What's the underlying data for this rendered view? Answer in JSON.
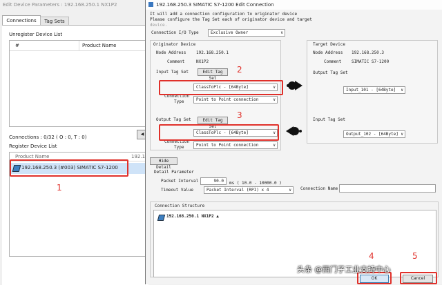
{
  "back_window": {
    "title": "Edit Device Parameters : 192.168.250.1 NX1P2",
    "tabs": [
      "Connections",
      "Tag Sets"
    ],
    "unregister_label": "Unregister Device List",
    "col_hash": "#",
    "col_product": "Product Name",
    "connections_label": "Connections :  0/32 ( O : 0, T : 0)",
    "register_label": "Register Device List",
    "reg_col_product": "Product Name",
    "reg_col_ip": "192.16",
    "device_row": "192.168.250.3 (#003) SIMATIC S7-1200"
  },
  "dialog": {
    "title": "192.168.250.3 SIMATIC S7-1200 Edit Connection",
    "desc1": "It will add a connection configuration to originator device",
    "desc2": "Please configure the Tag Set each of originator device and target",
    "desc3": "device.",
    "conn_type_label": "Connection I/O Type",
    "conn_type_value": "Exclusive Owner",
    "originator": {
      "heading": "Originator Device",
      "node_label": "Node Address",
      "node_value": "192.168.250.1",
      "comment_label": "Comment",
      "comment_value": "NX1P2",
      "input_label": "Input Tag Set",
      "edit_btn": "Edit Tag Set",
      "input_value": "ClassToPlc - [64Byte]",
      "ctype_label1": "Connection",
      "ctype_label2": "Type",
      "ctype_value": "Point to Point connection",
      "output_label": "Output Tag Set",
      "output_value": "ClassToPlc - [64Byte]"
    },
    "target": {
      "heading": "Target Device",
      "node_label": "Node Address",
      "node_value": "192.168.250.3",
      "comment_label": "Comment",
      "comment_value": "SIMATIC S7-1200",
      "output_label": "Output Tag Set",
      "output_value": "Input_101 - [64Byte]",
      "input_label": "Input Tag Set",
      "input_value": "Output_102 - [64Byte]"
    },
    "hide_detail": "Hide Detail",
    "detail_heading": "Detail Parameter",
    "packet_label": "Packet Interval",
    "packet_value": "90.0",
    "packet_unit": "ms ( 10.0 - 10000.0 )",
    "timeout_label": "Timeout Value",
    "timeout_value": "Packet Interval (RPI) x 4",
    "conn_name_label": "Connection Name",
    "structure_heading": "Connection Structure",
    "structure_item": "192.168.250.1  NX1P2  ▲",
    "ok_btn": "OK",
    "cancel_btn": "Cancel"
  },
  "annotations": {
    "n1": "1",
    "n2": "2",
    "n3": "3",
    "n4": "4",
    "n5": "5"
  },
  "watermark": "头条 @西门子工业支持中心",
  "colors": {
    "accent_red": "#e0302a",
    "highlight_row": "#cfe3f8"
  }
}
